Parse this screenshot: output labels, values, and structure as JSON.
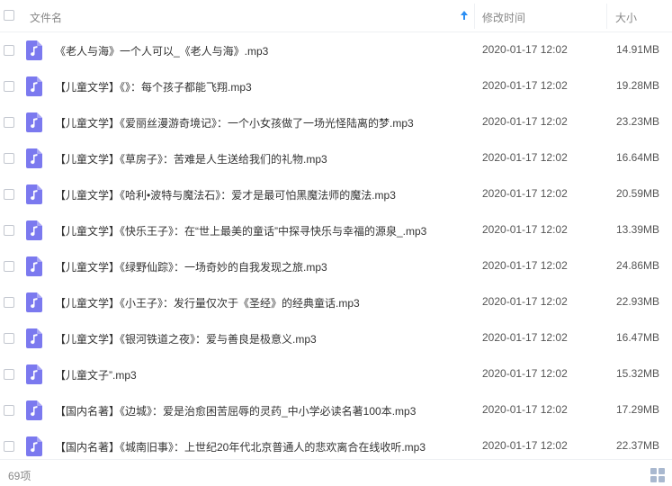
{
  "header": {
    "name_label": "文件名",
    "time_label": "修改时间",
    "size_label": "大小",
    "sort_direction": "ascending",
    "sort_icon": "arrow-up-icon"
  },
  "files": [
    {
      "name": "《老人与海》一个人可以_《老人与海》.mp3",
      "time": "2020-01-17 12:02",
      "size": "14.91MB"
    },
    {
      "name": "【儿童文学】《》：每个孩子都能飞翔.mp3",
      "time": "2020-01-17 12:02",
      "size": "19.28MB"
    },
    {
      "name": "【儿童文学】《爱丽丝漫游奇境记》：一个小女孩做了一场光怪陆离的梦.mp3",
      "time": "2020-01-17 12:02",
      "size": "23.23MB"
    },
    {
      "name": "【儿童文学】《草房子》：苦难是人生送给我们的礼物.mp3",
      "time": "2020-01-17 12:02",
      "size": "16.64MB"
    },
    {
      "name": "【儿童文学】《哈利•波特与魔法石》：爱才是最可怕黑魔法师的魔法.mp3",
      "time": "2020-01-17 12:02",
      "size": "20.59MB"
    },
    {
      "name": "【儿童文学】《快乐王子》：在“世上最美的童话”中探寻快乐与幸福的源泉_.mp3",
      "time": "2020-01-17 12:02",
      "size": "13.39MB"
    },
    {
      "name": "【儿童文学】《绿野仙踪》：一场奇妙的自我发现之旅.mp3",
      "time": "2020-01-17 12:02",
      "size": "24.86MB"
    },
    {
      "name": "【儿童文学】《小王子》：发行量仅次于《圣经》的经典童话.mp3",
      "time": "2020-01-17 12:02",
      "size": "22.93MB"
    },
    {
      "name": "【儿童文学】《银河铁道之夜》：爱与善良是极意义.mp3",
      "time": "2020-01-17 12:02",
      "size": "16.47MB"
    },
    {
      "name": "【儿童文子”.mp3",
      "time": "2020-01-17 12:02",
      "size": "15.32MB"
    },
    {
      "name": "【国内名著】《边城》：爱是治愈困苦屈辱的灵药_中小学必读名著100本.mp3",
      "time": "2020-01-17 12:02",
      "size": "17.29MB"
    },
    {
      "name": "【国内名著】《城南旧事》：上世纪20年代北京普通人的悲欢离合在线收听.mp3",
      "time": "2020-01-17 12:02",
      "size": "22.37MB"
    }
  ],
  "file_icon": "audio-file-icon",
  "footer": {
    "count": "69项",
    "view_icon": "grid-view-icon"
  },
  "colors": {
    "accent": "#2b8ef3",
    "file_icon": "#7b79ef",
    "header_text": "#888888",
    "border": "#eef0f3"
  }
}
